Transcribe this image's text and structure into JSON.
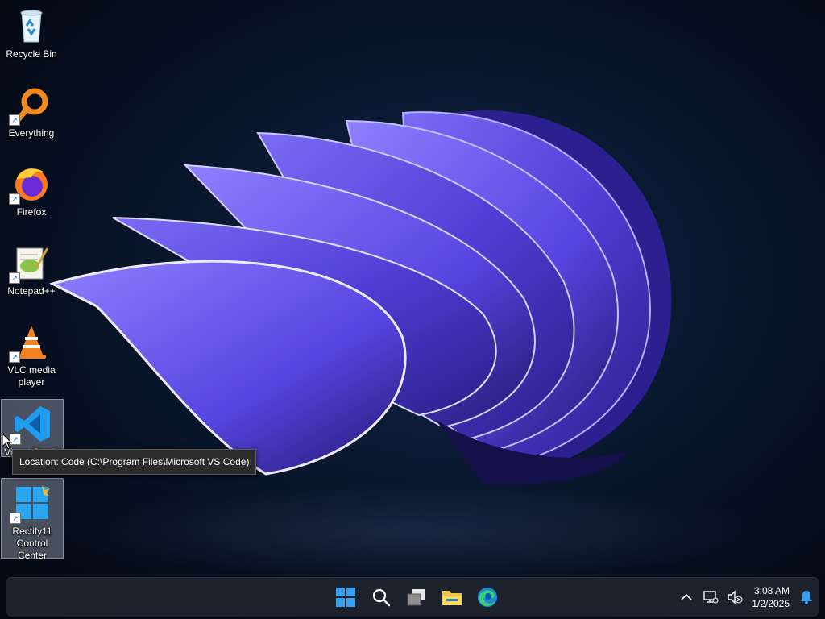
{
  "desktop": {
    "icons": [
      {
        "label": "Recycle Bin",
        "icon": "recycle-bin-icon"
      },
      {
        "label": "Everything",
        "icon": "everything-search-icon"
      },
      {
        "label": "Firefox",
        "icon": "firefox-icon"
      },
      {
        "label": "Notepad++",
        "icon": "notepad-plus-plus-icon"
      },
      {
        "label": "VLC media player",
        "icon": "vlc-icon"
      },
      {
        "label": "Visual Studio Code",
        "icon": "vscode-icon"
      },
      {
        "label": "Rectify11 Control Center",
        "icon": "rectify11-icon"
      }
    ]
  },
  "tooltip": {
    "text": "Location: Code (C:\\Program Files\\Microsoft VS Code)"
  },
  "taskbar": {
    "apps": [
      "start-icon",
      "search-icon",
      "task-view-icon",
      "file-explorer-icon",
      "edge-icon"
    ],
    "tray": {
      "time": "3:08 AM",
      "date": "1/2/2025",
      "icons": [
        "chevron-up-icon",
        "network-icon",
        "volume-muted-icon",
        "notification-bell-icon"
      ]
    }
  },
  "colors": {
    "accent": "#4f46d8",
    "taskbar_bg": "#1d232c",
    "tooltip_bg": "#2b2b2b"
  }
}
